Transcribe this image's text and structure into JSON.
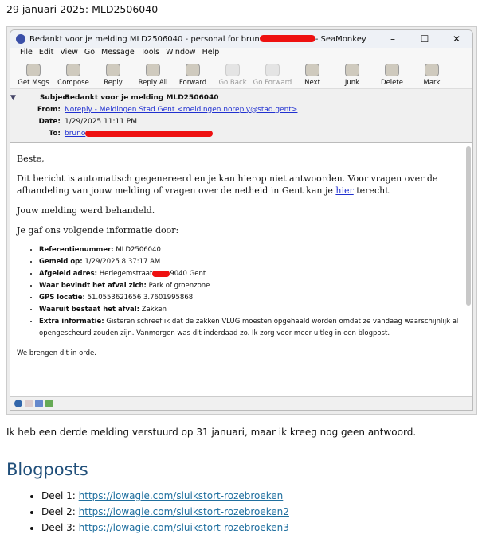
{
  "heading": "29 januari 2025: MLD2506040",
  "window": {
    "title_prefix": "Bedankt voor je melding MLD2506040 - personal for brun",
    "title_suffix": "- SeaMonkey",
    "minimize": "–",
    "maximize": "☐",
    "close": "✕"
  },
  "menu": [
    "File",
    "Edit",
    "View",
    "Go",
    "Message",
    "Tools",
    "Window",
    "Help"
  ],
  "toolbar": [
    {
      "label": "Get Msgs",
      "enabled": true
    },
    {
      "label": "Compose",
      "enabled": true
    },
    {
      "label": "Reply",
      "enabled": true
    },
    {
      "label": "Reply All",
      "enabled": true
    },
    {
      "label": "Forward",
      "enabled": true
    },
    {
      "label": "Go Back",
      "enabled": false
    },
    {
      "label": "Go Forward",
      "enabled": false
    },
    {
      "label": "Next",
      "enabled": true
    },
    {
      "label": "Junk",
      "enabled": true
    },
    {
      "label": "Delete",
      "enabled": true
    },
    {
      "label": "Mark",
      "enabled": true
    }
  ],
  "headers": {
    "subject_label": "Subject:",
    "subject": "Bedankt voor je melding MLD2506040",
    "from_label": "From:",
    "from": "Noreply - Meldingen Stad Gent <meldingen.noreply@stad.gent>",
    "date_label": "Date:",
    "date": "1/29/2025 11:11 PM",
    "to_label": "To:",
    "to": "bruno"
  },
  "message": {
    "greeting": "Beste,",
    "p1_a": "Dit bericht is automatisch gegenereerd en je kan hierop niet antwoorden. Voor vragen over de afhandeling van jouw melding of vragen over de netheid in Gent kan je ",
    "p1_link": "hier",
    "p1_b": " terecht.",
    "p2": "Jouw melding werd behandeld.",
    "p3": "Je gaf ons volgende informatie door:",
    "items": [
      {
        "k": "Referentienummer:",
        "v": " MLD2506040"
      },
      {
        "k": "Gemeld op:",
        "v": " 1/29/2025 8:37:17 AM"
      },
      {
        "k": "Afgeleid adres:",
        "v": " Herlegemstraat",
        "v2": "9040 Gent"
      },
      {
        "k": "Waar bevindt het afval zich:",
        "v": " Park of groenzone"
      },
      {
        "k": "GPS locatie:",
        "v": " 51.0553621656  3.7601995868"
      },
      {
        "k": "Waaruit bestaat het afval:",
        "v": " Zakken"
      },
      {
        "k": "Extra informatie:",
        "v": " Gisteren schreef ik dat de zakken VLUG moesten opgehaald worden omdat ze vandaag waarschijnlijk al opengescheurd zouden zijn. Vanmorgen was dit inderdaad zo. Ik zorg voor meer uitleg in een blogpost."
      }
    ],
    "closing": "We brengen dit in orde."
  },
  "after": "Ik heb een derde melding verstuurd op 31 januari, maar ik kreeg nog geen antwoord.",
  "blog": {
    "title": "Blogposts",
    "items": [
      {
        "label": "Deel 1: ",
        "url": "https://lowagie.com/sluikstort-rozebroeken"
      },
      {
        "label": "Deel 2: ",
        "url": "https://lowagie.com/sluikstort-rozebroeken2"
      },
      {
        "label": "Deel 3: ",
        "url": "https://lowagie.com/sluikstort-rozebroeken3"
      }
    ]
  }
}
